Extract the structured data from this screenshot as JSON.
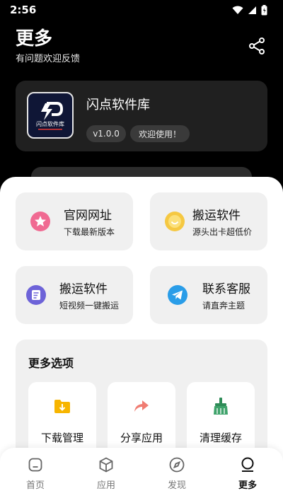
{
  "status_bar": {
    "time": "2:56"
  },
  "header": {
    "title": "更多",
    "subtitle": "有问题欢迎反馈"
  },
  "app_card": {
    "name": "闪点软件库",
    "logo_text": "闪点软件库",
    "version": "v1.0.0",
    "welcome": "欢迎使用！"
  },
  "tiles": [
    {
      "title": "官网网址",
      "subtitle": "下载最新版本",
      "icon": "star-badge-icon",
      "color": "#f06a92"
    },
    {
      "title": "搬运软件",
      "subtitle": "源头出卡超低价",
      "icon": "smile-icon",
      "color": "#f5c842"
    },
    {
      "title": "搬运软件",
      "subtitle": "短视频一键搬运",
      "icon": "document-icon",
      "color": "#6d63d8"
    },
    {
      "title": "联系客服",
      "subtitle": "请直奔主题",
      "icon": "telegram-icon",
      "color": "#2a9de8"
    }
  ],
  "more_options": {
    "title": "更多选项",
    "items": [
      {
        "label": "下载管理",
        "icon": "download-folder-icon"
      },
      {
        "label": "分享应用",
        "icon": "share-arrow-icon"
      },
      {
        "label": "清理缓存",
        "icon": "broom-icon"
      }
    ]
  },
  "tab_bar": {
    "items": [
      {
        "label": "首页",
        "icon": "home-icon"
      },
      {
        "label": "应用",
        "icon": "cube-icon"
      },
      {
        "label": "发现",
        "icon": "compass-icon"
      },
      {
        "label": "更多",
        "icon": "more-icon"
      }
    ],
    "active_index": 3
  }
}
